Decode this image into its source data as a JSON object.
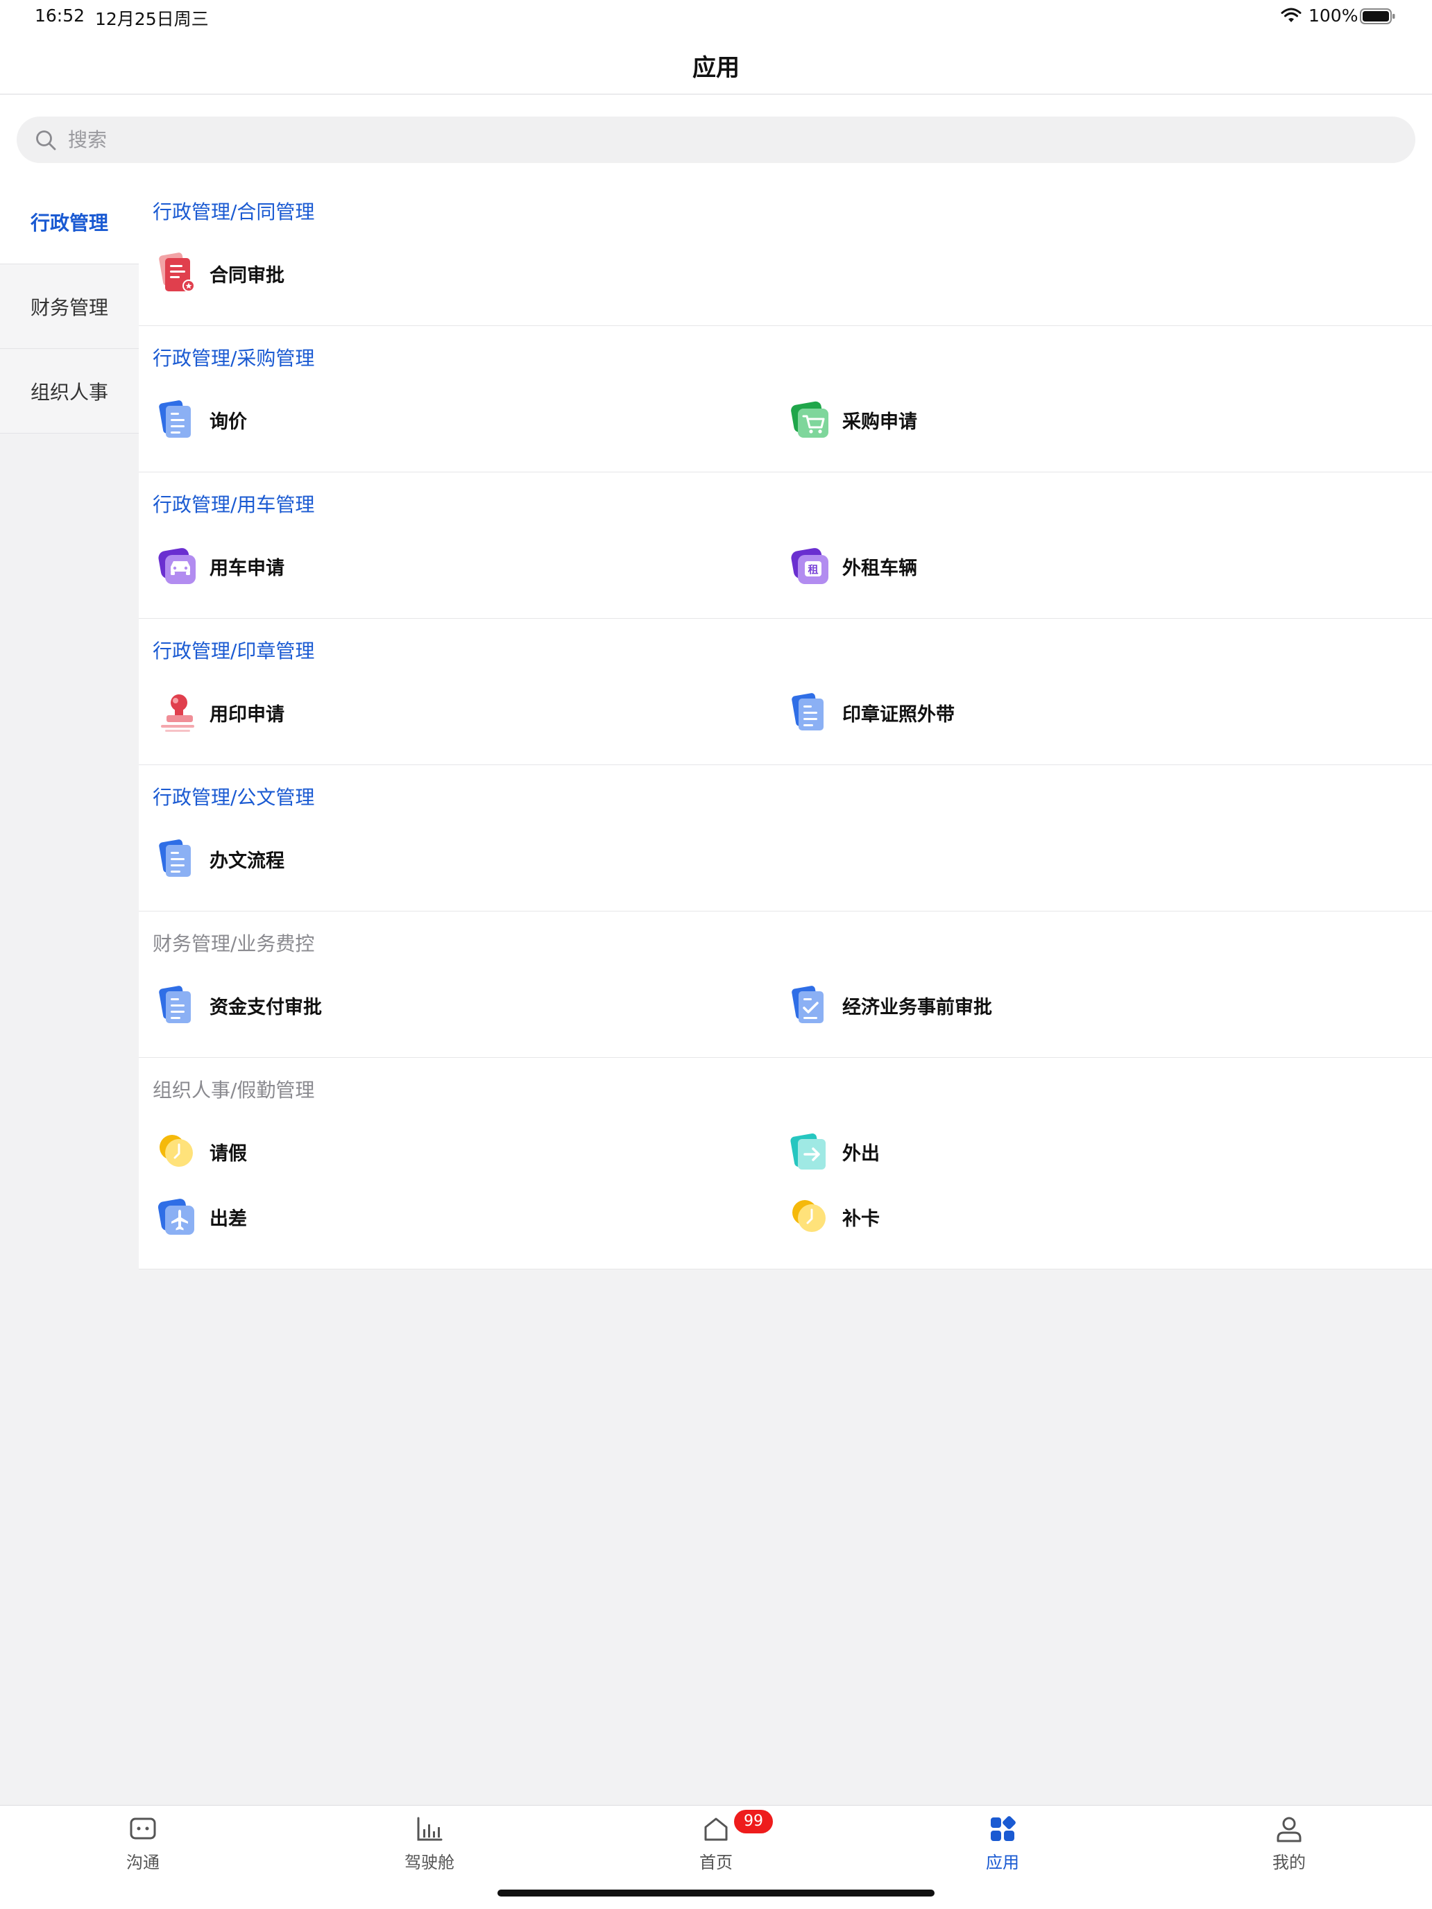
{
  "status_bar": {
    "time": "16:52",
    "date": "12月25日周三",
    "battery": "100%"
  },
  "header": {
    "title": "应用"
  },
  "search": {
    "placeholder": "搜索"
  },
  "categories": [
    {
      "label": "行政管理",
      "active": true
    },
    {
      "label": "财务管理",
      "active": false
    },
    {
      "label": "组织人事",
      "active": false
    }
  ],
  "sections": [
    {
      "title": "行政管理/合同管理",
      "items": [
        {
          "label": "合同审批",
          "icon": "contract-icon"
        }
      ]
    },
    {
      "title": "行政管理/采购管理",
      "items": [
        {
          "label": "询价",
          "icon": "document-icon"
        },
        {
          "label": "采购申请",
          "icon": "cart-icon"
        }
      ]
    },
    {
      "title": "行政管理/用车管理",
      "items": [
        {
          "label": "用车申请",
          "icon": "car-icon"
        },
        {
          "label": "外租车辆",
          "icon": "rent-icon"
        }
      ]
    },
    {
      "title": "行政管理/印章管理",
      "items": [
        {
          "label": "用印申请",
          "icon": "stamp-icon"
        },
        {
          "label": "印章证照外带",
          "icon": "document-icon"
        }
      ]
    },
    {
      "title": "行政管理/公文管理",
      "items": [
        {
          "label": "办文流程",
          "icon": "document-icon"
        }
      ]
    },
    {
      "title": "财务管理/业务费控",
      "items": [
        {
          "label": "资金支付审批",
          "icon": "document-icon"
        },
        {
          "label": "经济业务事前审批",
          "icon": "check-document-icon"
        }
      ]
    },
    {
      "title": "组织人事/假勤管理",
      "items": [
        {
          "label": "请假",
          "icon": "clock-icon"
        },
        {
          "label": "外出",
          "icon": "exit-icon"
        },
        {
          "label": "出差",
          "icon": "plane-icon"
        },
        {
          "label": "补卡",
          "icon": "clock-icon"
        }
      ]
    }
  ],
  "tabs": [
    {
      "label": "沟通",
      "icon": "chat-icon"
    },
    {
      "label": "驾驶舱",
      "icon": "bar-chart-icon"
    },
    {
      "label": "首页",
      "icon": "home-icon",
      "badge": "99"
    },
    {
      "label": "应用",
      "icon": "apps-icon",
      "active": true
    },
    {
      "label": "我的",
      "icon": "user-icon"
    }
  ],
  "colors": {
    "accent": "#1a5ad2",
    "badge": "#ee1c1c",
    "muted_title": "#8a8a8f"
  }
}
